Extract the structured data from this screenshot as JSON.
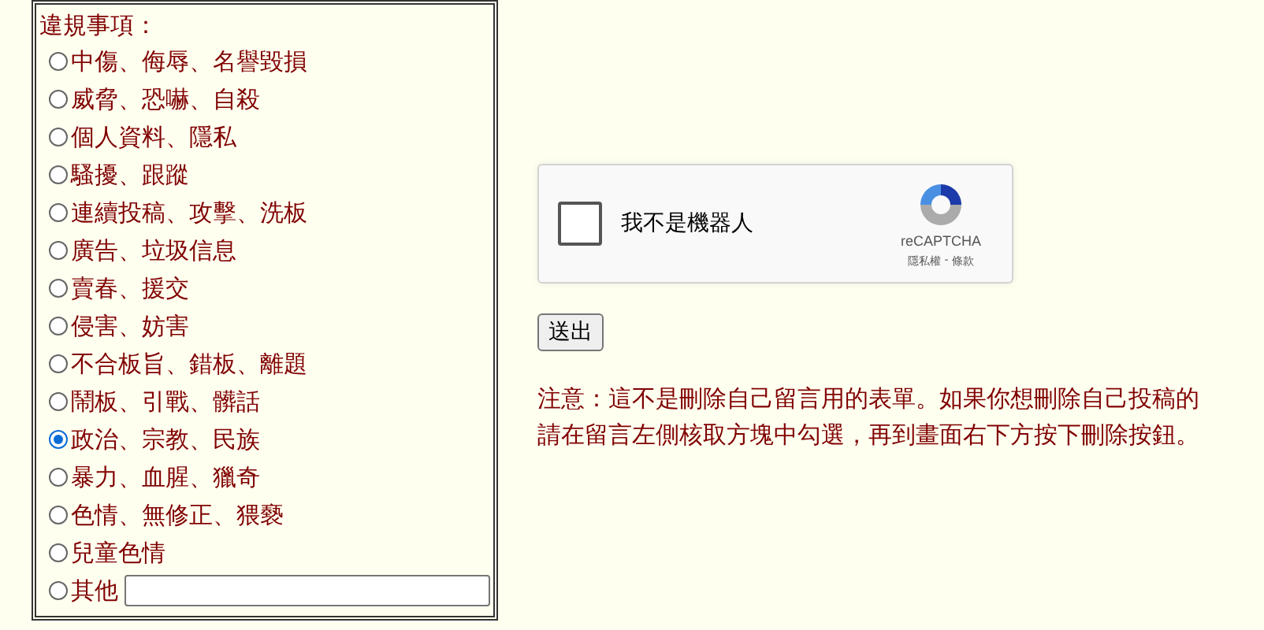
{
  "report_form": {
    "legend": "違規事項：",
    "options": [
      {
        "label": "中傷、侮辱、名譽毀損",
        "selected": false
      },
      {
        "label": "威脅、恐嚇、自殺",
        "selected": false
      },
      {
        "label": "個人資料、隱私",
        "selected": false
      },
      {
        "label": "騷擾、跟蹤",
        "selected": false
      },
      {
        "label": "連續投稿、攻擊、洗板",
        "selected": false
      },
      {
        "label": "廣告、垃圾信息",
        "selected": false
      },
      {
        "label": "賣春、援交",
        "selected": false
      },
      {
        "label": "侵害、妨害",
        "selected": false
      },
      {
        "label": "不合板旨、錯板、離題",
        "selected": false
      },
      {
        "label": "鬧板、引戰、髒話",
        "selected": false
      },
      {
        "label": "政治、宗教、民族",
        "selected": true
      },
      {
        "label": "暴力、血腥、獵奇",
        "selected": false
      },
      {
        "label": "色情、無修正、猥褻",
        "selected": false
      },
      {
        "label": "兒童色情",
        "selected": false
      },
      {
        "label": "其他",
        "selected": false,
        "kind": "other"
      }
    ]
  },
  "captcha": {
    "checked": false,
    "label": "我不是機器人",
    "brand": "reCAPTCHA",
    "privacy_link": "隱私權",
    "separator": "-",
    "terms_link": "條款"
  },
  "submit_button": "送出",
  "notice": [
    "注意：這不是刪除自己留言用的表單。如果你想刪除自己投稿的",
    "請在留言左側核取方塊中勾選，再到畫面右下方按下刪除按鈕。"
  ]
}
